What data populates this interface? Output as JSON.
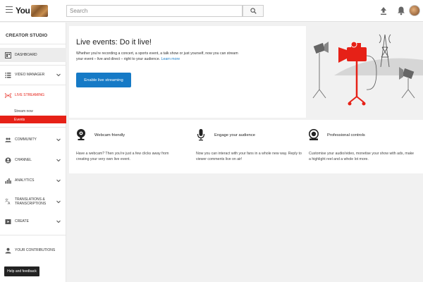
{
  "header": {
    "logo_text": "You",
    "search": {
      "placeholder": "Search",
      "value": ""
    }
  },
  "sidebar": {
    "title": "CREATOR STUDIO",
    "items": [
      {
        "label": "DASHBOARD",
        "icon": "dashboard-icon"
      },
      {
        "label": "VIDEO MANAGER",
        "icon": "video-manager-icon"
      },
      {
        "label": "LIVE STREAMING",
        "icon": "live-streaming-icon"
      },
      {
        "label": "COMMUNITY",
        "icon": "community-icon"
      },
      {
        "label": "CHANNEL",
        "icon": "channel-icon"
      },
      {
        "label": "ANALYTICS",
        "icon": "analytics-icon"
      },
      {
        "label": "TRANSLATIONS & TRANSCRIPTIONS",
        "icon": "translate-icon"
      },
      {
        "label": "CREATE",
        "icon": "create-icon"
      },
      {
        "label": "YOUR CONTRIBUTIONS",
        "icon": "contributions-icon"
      }
    ],
    "live_sub_items": [
      {
        "label": "Stream now"
      },
      {
        "label": "Events"
      }
    ],
    "help_label": "Help and feedback"
  },
  "hero": {
    "title": "Live events: Do it live!",
    "description": "Whether you're recording a concert, a sports event, a talk show or just yourself, now you can stream your event – live and direct – right to your audience.",
    "learn_more": "Learn more",
    "button_label": "Enable live streaming"
  },
  "features": [
    {
      "icon": "webcam-icon",
      "title": "Webcam friendly",
      "description": "Have a webcam? Then you're just a few clicks away from creating your very own live event."
    },
    {
      "icon": "microphone-icon",
      "title": "Engage your audience",
      "description": "Now you can interact with your fans in a whole new way. Reply to viewer comments live on air!"
    },
    {
      "icon": "professional-controls-icon",
      "title": "Professional controls",
      "description": "Customise your audio/video, monetise your show with ads, make a highlight reel and a whole lot more."
    }
  ],
  "colors": {
    "accent_red": "#e62117",
    "link_blue": "#167ac6",
    "background": "#f1f1f1"
  }
}
